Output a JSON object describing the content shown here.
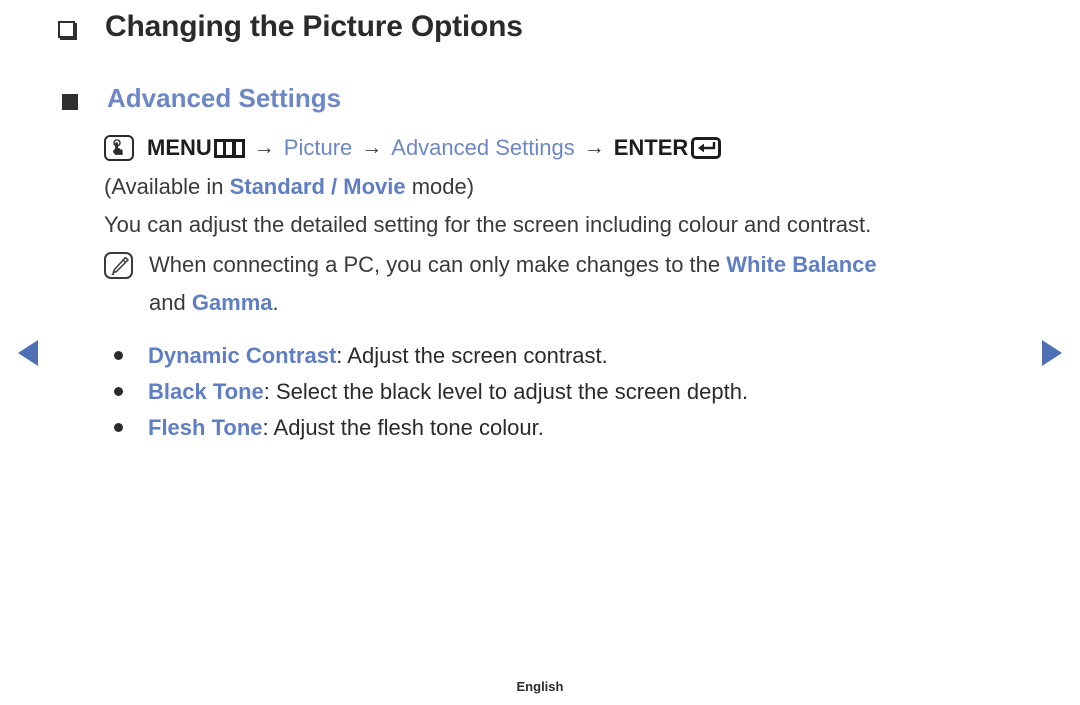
{
  "page": {
    "title": "Changing the Picture Options",
    "section_heading": "Advanced Settings",
    "footer_language": "English"
  },
  "menu_path": {
    "touch_icon": "touch-hand-icon",
    "menu_label": "MENU",
    "menu_icon": "menu-grid-icon",
    "arrow1": "→",
    "item1": "Picture",
    "arrow2": "→",
    "item2": "Advanced Settings",
    "arrow3": "→",
    "enter_label": "ENTER",
    "enter_icon": "enter-return-icon"
  },
  "availability": {
    "prefix": "(Available in ",
    "modes": "Standard / Movie",
    "suffix": " mode)"
  },
  "description": "You can adjust the detailed setting for the screen including colour and contrast.",
  "note": {
    "icon": "note-pen-icon",
    "text_before": "When connecting a PC, you can only make changes to the ",
    "highlight1": "White Balance",
    "text_middle": "and ",
    "highlight2": "Gamma",
    "text_after": "."
  },
  "options": [
    {
      "name": "Dynamic Contrast",
      "separator": ": ",
      "description": "Adjust the screen contrast."
    },
    {
      "name": "Black Tone",
      "separator": ": ",
      "description": "Select the black level to adjust the screen depth."
    },
    {
      "name": "Flesh Tone",
      "separator": ": ",
      "description": "Adjust the flesh tone colour."
    }
  ],
  "navigation": {
    "prev_icon": "arrow-left-icon",
    "next_icon": "arrow-right-icon"
  },
  "colors": {
    "accent_blue": "#6d87c6",
    "nav_blue": "#4f70b5",
    "text_dark": "#3a3a3a"
  }
}
